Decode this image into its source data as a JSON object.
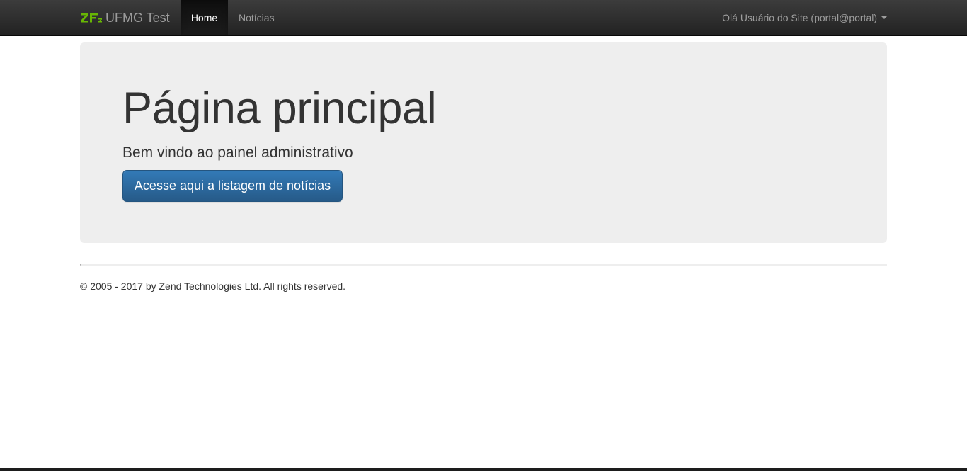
{
  "navbar": {
    "brand": "UFMG Test",
    "brand_logo_icon": "zf2-logo-icon",
    "brand_logo_color": "#68b604",
    "items": [
      {
        "label": "Home",
        "active": true
      },
      {
        "label": "Notícias",
        "active": false
      }
    ],
    "user_menu_label": "Olá Usuário do Site (portal@portal)"
  },
  "jumbotron": {
    "title": "Página principal",
    "subtitle": "Bem vindo ao painel administrativo",
    "button_label": "Acesse aqui a listagem de notícias"
  },
  "footer": {
    "text": "© 2005 - 2017 by Zend Technologies Ltd. All rights reserved."
  },
  "colors": {
    "navbar_bg": "#222222",
    "jumbotron_bg": "#eeeeee",
    "primary_button": "#337ab7",
    "zf_green": "#68b604"
  }
}
